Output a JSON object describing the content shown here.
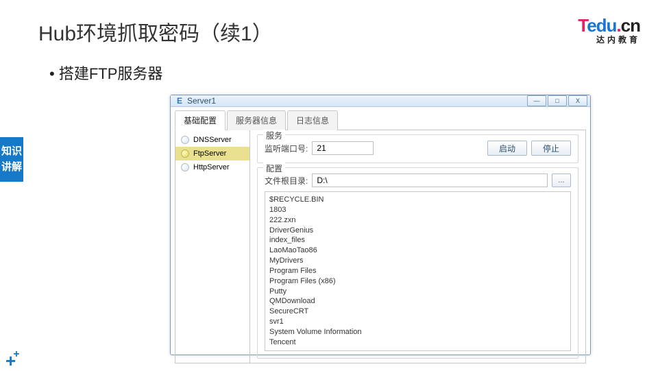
{
  "slide": {
    "title": "Hub环境抓取密码（续1）",
    "bullet": "•  搭建FTP服务器",
    "side_tag": "知识讲解"
  },
  "brand": {
    "t": "T",
    "edu": "edu",
    "dot": ".",
    "cn": "cn",
    "sub": "达内教育"
  },
  "window": {
    "title": "Server1",
    "icon": "E",
    "btn_min": "—",
    "btn_max": "□",
    "btn_close": "X"
  },
  "tabs": [
    "基础配置",
    "服务器信息",
    "日志信息"
  ],
  "active_tab": 0,
  "sidebar": {
    "items": [
      {
        "label": "DNSServer"
      },
      {
        "label": "FtpServer"
      },
      {
        "label": "HttpServer"
      }
    ],
    "active": 1
  },
  "service_group": {
    "title": "服务",
    "port_label": "监听端口号:",
    "port_value": "21",
    "start_btn": "启动",
    "stop_btn": "停止"
  },
  "config_group": {
    "title": "配置",
    "root_label": "文件根目录:",
    "root_value": "D:\\",
    "browse": "..."
  },
  "file_list": [
    "$RECYCLE.BIN",
    "1803",
    "222.zxn",
    "DriverGenius",
    "index_files",
    "LaoMaoTao86",
    "MyDrivers",
    "Program Files",
    "Program Files (x86)",
    "Putty",
    "QMDownload",
    "SecureCRT",
    "svr1",
    "System Volume Information",
    "Tencent"
  ]
}
